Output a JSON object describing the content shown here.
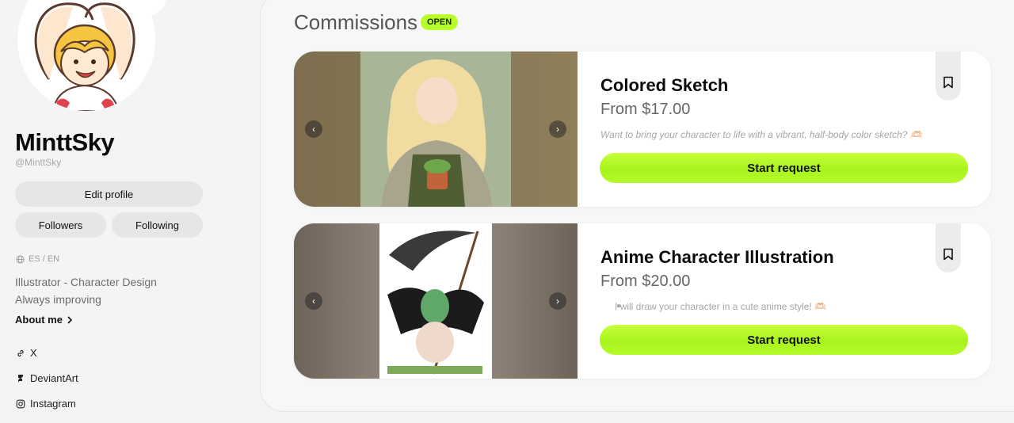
{
  "profile": {
    "display_name": "MinttSky",
    "handle": "@MinttSky",
    "edit_profile": "Edit profile",
    "followers": "Followers",
    "following": "Following",
    "languages": "ES / EN",
    "bio_line1": "Illustrator - Character Design",
    "bio_line2": "Always improving",
    "about_me": "About me",
    "links": [
      {
        "label": "X",
        "icon": "link-icon"
      },
      {
        "label": "DeviantArt",
        "icon": "deviantart-icon"
      },
      {
        "label": "Instagram",
        "icon": "instagram-icon"
      }
    ]
  },
  "commissions": {
    "title": "Commissions",
    "status_badge": "OPEN",
    "cards": [
      {
        "title": "Colored Sketch",
        "price": "From $17.00",
        "description": "Want to bring your character to life with a vibrant, half-body color sketch? 🫶🏻",
        "button": "Start request",
        "image": "gardener-character-artwork"
      },
      {
        "title": "Anime Character Illustration",
        "price": "From $20.00",
        "description": "I will draw your character in a cute anime style! 🫶🏻",
        "button": "Start request",
        "image": "scythe-character-artwork"
      }
    ]
  },
  "colors": {
    "accent": "#b6ff2a",
    "background": "#f4f4f4",
    "card": "#ffffff"
  }
}
